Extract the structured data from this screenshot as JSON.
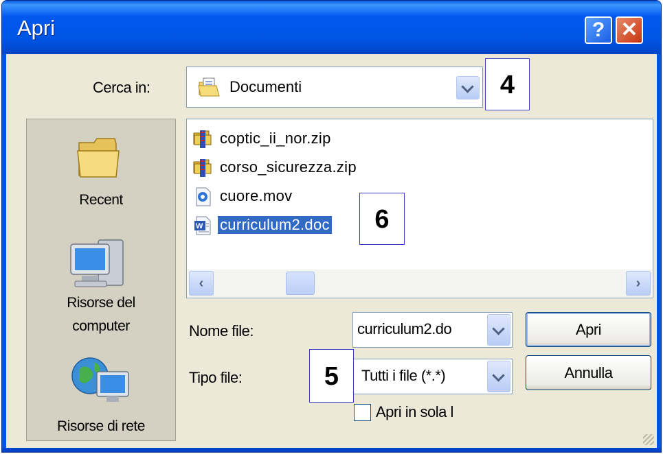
{
  "window": {
    "title": "Apri",
    "help_glyph": "?",
    "close_glyph": "✕"
  },
  "look_in": {
    "label": "Cerca in:",
    "value": "Documenti",
    "icon": "documents-folder-icon"
  },
  "places": [
    {
      "label": "Recent",
      "icon": "recent-folder-icon"
    },
    {
      "label_line1": "Risorse del",
      "label_line2": "computer",
      "icon": "my-computer-icon"
    },
    {
      "label": "Risorse di rete",
      "icon": "network-places-icon"
    }
  ],
  "files": [
    {
      "name": "coptic_ii_nor.zip",
      "icon": "zip-archive-icon",
      "selected": false
    },
    {
      "name": "corso_sicurezza.zip",
      "icon": "zip-archive-icon",
      "selected": false
    },
    {
      "name": "cuore.mov",
      "icon": "video-file-icon",
      "selected": false
    },
    {
      "name": "curriculum2.doc",
      "icon": "word-document-icon",
      "selected": true
    }
  ],
  "scrollbar": {
    "left_glyph": "‹",
    "right_glyph": "›"
  },
  "file_name": {
    "label": "Nome file:",
    "value": "curriculum2.do"
  },
  "file_type": {
    "label": "Tipo file:",
    "value": "Tutti i file (*.*)"
  },
  "buttons": {
    "open": "Apri",
    "cancel": "Annulla"
  },
  "readonly": {
    "label": "Apri in sola l",
    "checked": false
  },
  "callouts": {
    "look_in": "4",
    "file_type": "5",
    "selected_file": "6"
  },
  "colors": {
    "titlebar": "#0055e5",
    "selection": "#316ac5",
    "dialog_bg": "#ece9d8",
    "callout_border": "#3b3bd0"
  }
}
